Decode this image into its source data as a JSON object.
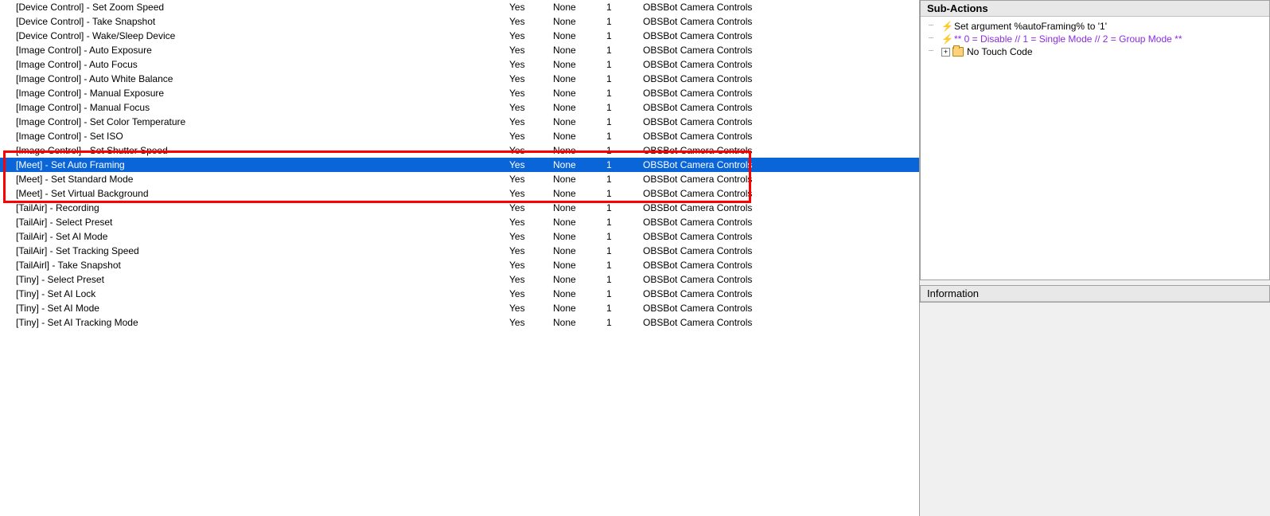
{
  "rows": [
    {
      "name": "[Device Control] - Set Zoom Speed",
      "enabled": "Yes",
      "random": "None",
      "concurrent": "1",
      "group": "OBSBot Camera Controls"
    },
    {
      "name": "[Device Control] - Take Snapshot",
      "enabled": "Yes",
      "random": "None",
      "concurrent": "1",
      "group": "OBSBot Camera Controls"
    },
    {
      "name": "[Device Control] - Wake/Sleep Device",
      "enabled": "Yes",
      "random": "None",
      "concurrent": "1",
      "group": "OBSBot Camera Controls"
    },
    {
      "name": "[Image Control] - Auto Exposure",
      "enabled": "Yes",
      "random": "None",
      "concurrent": "1",
      "group": "OBSBot Camera Controls"
    },
    {
      "name": "[Image Control] - Auto Focus",
      "enabled": "Yes",
      "random": "None",
      "concurrent": "1",
      "group": "OBSBot Camera Controls"
    },
    {
      "name": "[Image Control] - Auto White Balance",
      "enabled": "Yes",
      "random": "None",
      "concurrent": "1",
      "group": "OBSBot Camera Controls"
    },
    {
      "name": "[Image Control] - Manual Exposure",
      "enabled": "Yes",
      "random": "None",
      "concurrent": "1",
      "group": "OBSBot Camera Controls"
    },
    {
      "name": "[Image Control] - Manual Focus",
      "enabled": "Yes",
      "random": "None",
      "concurrent": "1",
      "group": "OBSBot Camera Controls"
    },
    {
      "name": "[Image Control] - Set Color Temperature",
      "enabled": "Yes",
      "random": "None",
      "concurrent": "1",
      "group": "OBSBot Camera Controls"
    },
    {
      "name": "[Image Control] - Set ISO",
      "enabled": "Yes",
      "random": "None",
      "concurrent": "1",
      "group": "OBSBot Camera Controls"
    },
    {
      "name": "[Image Control] - Set Shutter Speed",
      "enabled": "Yes",
      "random": "None",
      "concurrent": "1",
      "group": "OBSBot Camera Controls"
    },
    {
      "name": "[Meet] - Set Auto Framing",
      "enabled": "Yes",
      "random": "None",
      "concurrent": "1",
      "group": "OBSBot Camera Controls",
      "selected": true
    },
    {
      "name": "[Meet] - Set Standard Mode",
      "enabled": "Yes",
      "random": "None",
      "concurrent": "1",
      "group": "OBSBot Camera Controls"
    },
    {
      "name": "[Meet] - Set Virtual Background",
      "enabled": "Yes",
      "random": "None",
      "concurrent": "1",
      "group": "OBSBot Camera Controls"
    },
    {
      "name": "[TailAir] - Recording",
      "enabled": "Yes",
      "random": "None",
      "concurrent": "1",
      "group": "OBSBot Camera Controls"
    },
    {
      "name": "[TailAir] - Select Preset",
      "enabled": "Yes",
      "random": "None",
      "concurrent": "1",
      "group": "OBSBot Camera Controls"
    },
    {
      "name": "[TailAir] - Set AI Mode",
      "enabled": "Yes",
      "random": "None",
      "concurrent": "1",
      "group": "OBSBot Camera Controls"
    },
    {
      "name": "[TailAir] - Set Tracking Speed",
      "enabled": "Yes",
      "random": "None",
      "concurrent": "1",
      "group": "OBSBot Camera Controls"
    },
    {
      "name": "[TailAirl] - Take Snapshot",
      "enabled": "Yes",
      "random": "None",
      "concurrent": "1",
      "group": "OBSBot Camera Controls"
    },
    {
      "name": "[Tiny] - Select Preset",
      "enabled": "Yes",
      "random": "None",
      "concurrent": "1",
      "group": "OBSBot Camera Controls"
    },
    {
      "name": "[Tiny] - Set AI Lock",
      "enabled": "Yes",
      "random": "None",
      "concurrent": "1",
      "group": "OBSBot Camera Controls"
    },
    {
      "name": "[Tiny] - Set AI Mode",
      "enabled": "Yes",
      "random": "None",
      "concurrent": "1",
      "group": "OBSBot Camera Controls"
    },
    {
      "name": "[Tiny] - Set AI Tracking Mode",
      "enabled": "Yes",
      "random": "None",
      "concurrent": "1",
      "group": "OBSBot Camera Controls"
    }
  ],
  "subactions": {
    "header": "Sub-Actions",
    "items": [
      {
        "type": "bolt",
        "text": "Set argument %autoFraming% to '1'"
      },
      {
        "type": "bolt",
        "text": "** 0 = Disable // 1 = Single Mode // 2 = Group Mode **",
        "violet": true
      },
      {
        "type": "folder",
        "text": "No Touch Code",
        "expandable": true
      }
    ]
  },
  "information": {
    "header": "Information"
  }
}
